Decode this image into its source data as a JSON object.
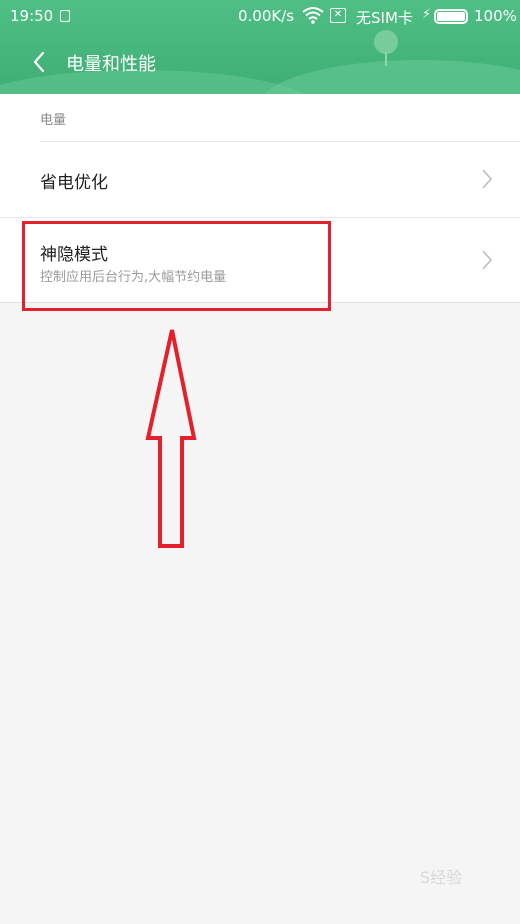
{
  "statusbar": {
    "time": "19:50",
    "speed": "0.00K/s",
    "carrier": "无SIM卡",
    "battery_pct": "100%",
    "battery_level": 1.0,
    "icons": [
      "sim-icon",
      "wifi-icon",
      "no-sim-icon",
      "charging-icon",
      "battery-icon"
    ]
  },
  "header": {
    "title": "电量和性能",
    "background_color": "#43b37a"
  },
  "section": {
    "label": "电量"
  },
  "items": [
    {
      "title": "省电优化",
      "subtitle": ""
    },
    {
      "title": "神隐模式",
      "subtitle": "控制应用后台行为,大幅节约电量"
    }
  ],
  "annotation": {
    "color": "#e3202b"
  },
  "watermark": "S经验"
}
